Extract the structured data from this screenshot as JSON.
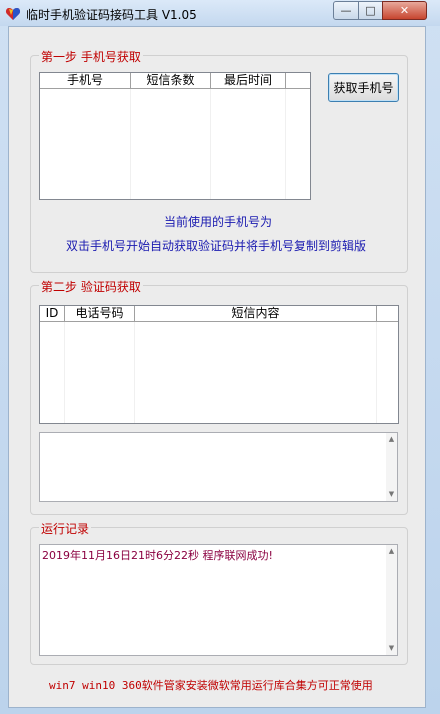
{
  "window": {
    "title": "临时手机验证码接码工具 V1.05",
    "min_glyph": "—",
    "max_glyph": "□",
    "close_glyph": "✕"
  },
  "step1": {
    "title": "第一步 手机号获取",
    "columns": [
      "手机号",
      "短信条数",
      "最后时间"
    ],
    "get_button": "获取手机号",
    "current_label": "当前使用的手机号为",
    "hint": "双击手机号开始自动获取验证码并将手机号复制到剪辑版"
  },
  "step2": {
    "title": "第二步 验证码获取",
    "columns": [
      "ID",
      "电话号码",
      "短信内容"
    ],
    "scroll_up": "▲",
    "scroll_down": "▼"
  },
  "log": {
    "title": "运行记录",
    "entries": [
      "2019年11月16日21时6分22秒  程序联网成功!"
    ],
    "scroll_up": "▲",
    "scroll_down": "▼"
  },
  "footer": {
    "note": "win7 win10 360软件管家安装微软常用运行库合集方可正常使用"
  },
  "colors": {
    "accent_red": "#c00000",
    "info_blue": "#1a1ab0"
  }
}
